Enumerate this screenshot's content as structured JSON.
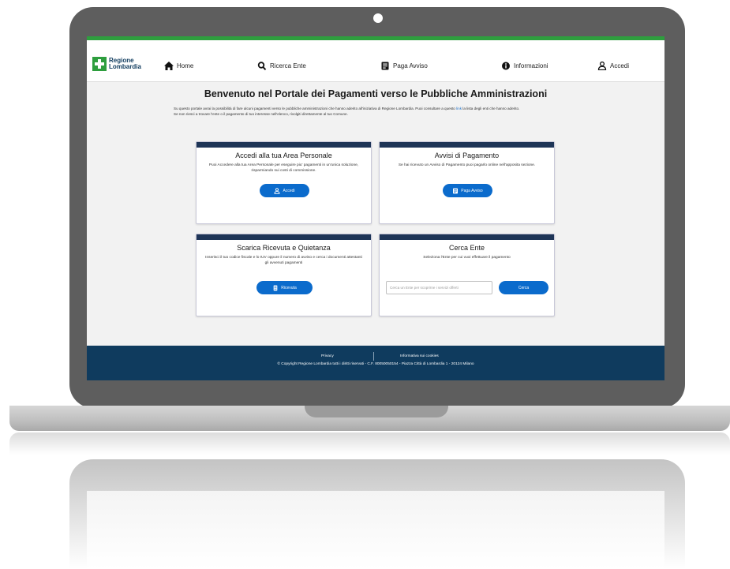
{
  "brand": {
    "logo_line1": "Regione",
    "logo_line2": "Lombardia",
    "accent_green": "#2e9e3e",
    "navy": "#0f3b5e",
    "button_blue": "#0b6bcc"
  },
  "nav": {
    "home": "Home",
    "ricerca_ente": "Ricerca Ente",
    "paga_avviso": "Paga Avviso",
    "informazioni": "Informazioni",
    "accedi": "Accedi"
  },
  "main": {
    "title": "Benvenuto nel Portale dei Pagamenti verso le Pubbliche Amministrazioni",
    "intro_1a": "Su questo portale avrai la possibilità di fare alcuni pagamenti verso le pubbliche amministrazioni che hanno aderito all'iniziativa di Regione Lombardia. Puoi consultare a questo ",
    "intro_link": "link",
    "intro_1b": " la lista degli enti che hanno aderito.",
    "intro_2": "Se non riesci a trovare l'ente o il pagamento di tuo interesse nell'elenco, rivolgiti direttamente al tuo Comune."
  },
  "cards": {
    "area_personale": {
      "title": "Accedi alla tua Area Personale",
      "desc": "Puoi Accedere alla tua Area Personale per eseguire piu' pagamenti in un'unica soluzione, risparmiando sui costi di commissione.",
      "button": "Accedi"
    },
    "avvisi": {
      "title": "Avvisi di Pagamento",
      "desc": "Se hai ricevuto un Avviso di Pagamento puoi pagarlo online nell'apposita sezione.",
      "button": "Paga Avviso"
    },
    "ricevuta": {
      "title": "Scarica Ricevuta e Quietanza",
      "desc": "Inserisci il tuo codice fiscale e lo IUV oppure il numero di avviso e cerca i documenti attestanti gli avvenuti pagamenti",
      "button": "Ricevuta"
    },
    "cerca_ente": {
      "title": "Cerca Ente",
      "desc": "Seleziona l'Ente per cui vuoi effettuare il pagamento",
      "input_placeholder": "Cerca un Ente per scoprirne i servizi offerti",
      "button": "Cerca"
    }
  },
  "footer": {
    "privacy": "Privacy",
    "cookies": "Informativa sui cookies",
    "copyright": "© Copyright Regione Lombardia tutti i diritti riservati - C.F. 80050050154 - Piazza Città di Lombardia 1 - 20124 Milano"
  }
}
